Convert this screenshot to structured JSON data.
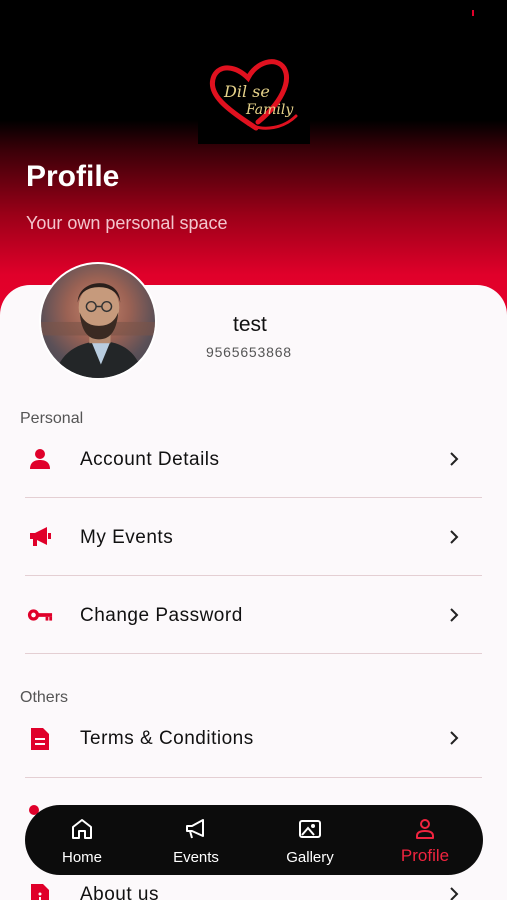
{
  "brand": {
    "logo_text_line1": "Dil se",
    "logo_text_line2": "Family"
  },
  "header": {
    "title": "Profile",
    "subtitle": "Your own personal space"
  },
  "user": {
    "name": "test",
    "phone": "9565653868"
  },
  "sections": {
    "personal": {
      "label": "Personal",
      "items": [
        {
          "label": "Account Details",
          "icon": "user-icon"
        },
        {
          "label": "My Events",
          "icon": "megaphone-icon"
        },
        {
          "label": "Change Password",
          "icon": "key-icon"
        }
      ]
    },
    "others": {
      "label": "Others",
      "items": [
        {
          "label": "Terms & Conditions",
          "icon": "document-icon"
        },
        {
          "label": "About us",
          "icon": "info-document-icon"
        }
      ]
    }
  },
  "bottom_nav": {
    "items": [
      {
        "label": "Home",
        "icon": "home-icon"
      },
      {
        "label": "Events",
        "icon": "megaphone-icon"
      },
      {
        "label": "Gallery",
        "icon": "image-icon"
      },
      {
        "label": "Profile",
        "icon": "profile-icon",
        "active": true
      }
    ]
  },
  "colors": {
    "accent": "#e0002a",
    "nav_bg": "#0c0c0c",
    "active_tab": "#f0243f"
  }
}
